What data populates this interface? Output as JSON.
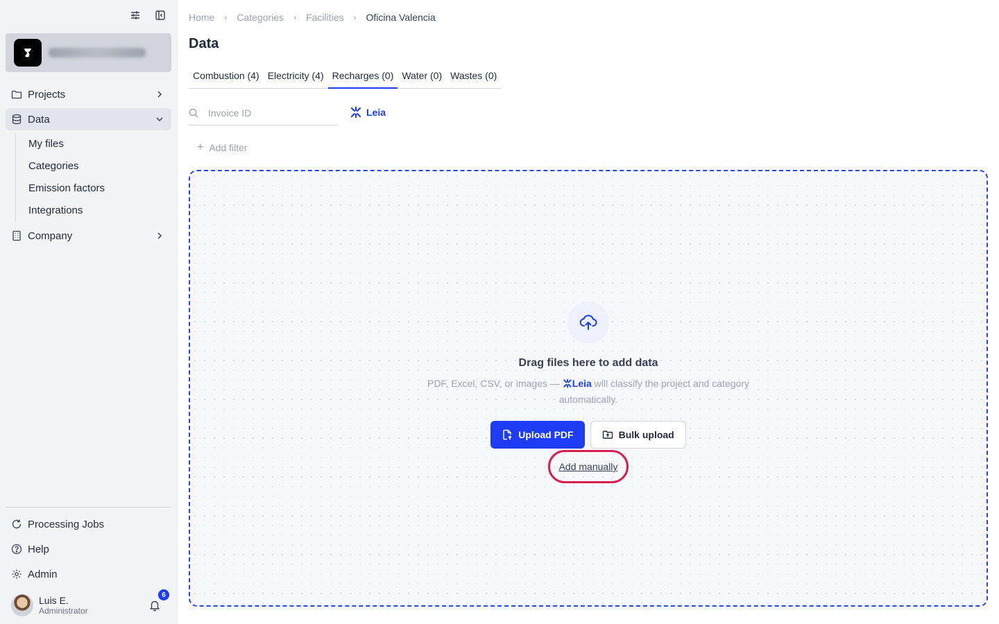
{
  "sidebar": {
    "nav": [
      {
        "label": "Projects",
        "icon": "folder-icon"
      },
      {
        "label": "Data",
        "icon": "database-icon"
      },
      {
        "label": "Company",
        "icon": "building-icon"
      }
    ],
    "data_subitems": [
      "My files",
      "Categories",
      "Emission factors",
      "Integrations"
    ],
    "bottom": [
      {
        "label": "Processing Jobs",
        "icon": "refresh-icon"
      },
      {
        "label": "Help",
        "icon": "help-icon"
      },
      {
        "label": "Admin",
        "icon": "gear-icon"
      }
    ],
    "user": {
      "name": "Luis E.",
      "role": "Administrator",
      "notifications": "6"
    }
  },
  "breadcrumb": [
    "Home",
    "Categories",
    "Facilities",
    "Oficina Valencia"
  ],
  "page_title": "Data",
  "tabs": [
    "Combustion (4)",
    "Electricity (4)",
    "Recharges (0)",
    "Water (0)",
    "Wastes (0)"
  ],
  "active_tab": "Recharges (0)",
  "search": {
    "placeholder": "Invoice ID",
    "value": ""
  },
  "leia_label": "Leia",
  "add_filter_label": "Add filter",
  "dropzone": {
    "title": "Drag files here to add data",
    "subtitle_prefix": "PDF, Excel, CSV, or images —",
    "subtitle_leia": "Leia",
    "subtitle_suffix": "will classify the project and category automatically.",
    "upload_pdf": "Upload PDF",
    "bulk_upload": "Bulk upload",
    "add_manually": "Add manually"
  },
  "colors": {
    "accent": "#1d3cf4",
    "highlight": "#d61f4e"
  }
}
